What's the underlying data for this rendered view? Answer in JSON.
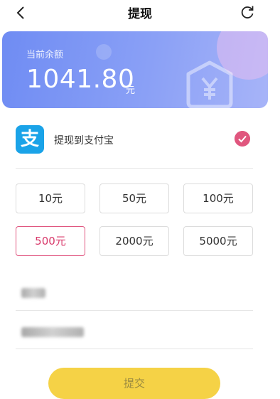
{
  "nav": {
    "title": "提现",
    "back_icon": "chevron-left-icon",
    "refresh_icon": "refresh-icon"
  },
  "balance": {
    "label": "当前余额",
    "amount": "1041.80",
    "unit": "元",
    "watermark_icon": "yen-shield-icon"
  },
  "method": {
    "label": "提现到支付宝",
    "icon_glyph": "支",
    "icon": "alipay-icon",
    "selected": true,
    "accent_color": "#e0567e"
  },
  "amount_options": [
    {
      "label": "10元",
      "selected": false
    },
    {
      "label": "50元",
      "selected": false
    },
    {
      "label": "100元",
      "selected": false
    },
    {
      "label": "500元",
      "selected": true
    },
    {
      "label": "2000元",
      "selected": false
    },
    {
      "label": "5000元",
      "selected": false
    }
  ],
  "submit": {
    "label": "提交",
    "color": "#f5d246"
  },
  "colors": {
    "card_start": "#6f8cf3",
    "card_end": "#a7b4f8",
    "selected_amount": "#d8386a"
  }
}
